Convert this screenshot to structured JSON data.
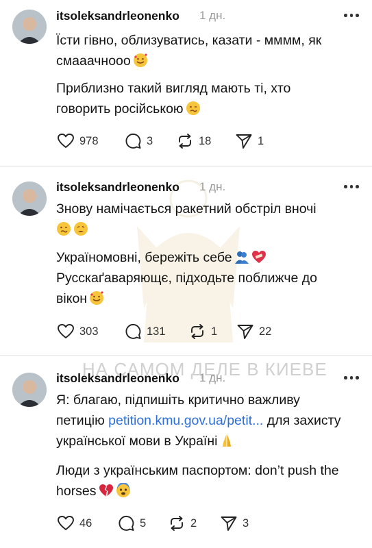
{
  "posts": [
    {
      "username": "itsoleksandrleonenko",
      "time": "1 дн.",
      "paragraphs": [
        [
          "Їсти гівно, облизуватись, казати - мммм, як",
          "смааачнооо"
        ],
        [
          "Приблизно такий вигляд мають ті, хто",
          "говорить російською"
        ]
      ],
      "likes": "978",
      "replies": "3",
      "reposts": "18",
      "shares": "1"
    },
    {
      "username": "itsoleksandrleonenko",
      "time": "1 дн.",
      "paragraphs": [
        [
          "Знову намічається ракетний обстріл вночі",
          ""
        ],
        [
          "Україномовні, бережіть себе",
          "Русскаґаваряющє, підходьте поближче до",
          "вікон"
        ]
      ],
      "likes": "303",
      "replies": "131",
      "reposts": "1",
      "shares": "22"
    },
    {
      "username": "itsoleksandrleonenko",
      "time": "1 дн.",
      "paragraphs": [
        [
          "Я: благаю, підпишіть критично важливу",
          "петицію",
          "petition.kmu.gov.ua/petit...",
          "для захисту",
          "української мови в Україні"
        ],
        [
          "Люди з українським паспортом: don’t push the",
          "horses"
        ]
      ],
      "likes": "46",
      "replies": "5",
      "reposts": "2",
      "shares": "3"
    }
  ],
  "watermark": "НА САМОМ ДЕЛЕ В КИЕВЕ",
  "colors": {
    "link": "#2e6fd9",
    "muted": "#9a9a9a",
    "divider": "#dcdcdc"
  },
  "icons": [
    "heart-icon",
    "comment-icon",
    "repost-icon",
    "send-icon",
    "more-icon"
  ]
}
